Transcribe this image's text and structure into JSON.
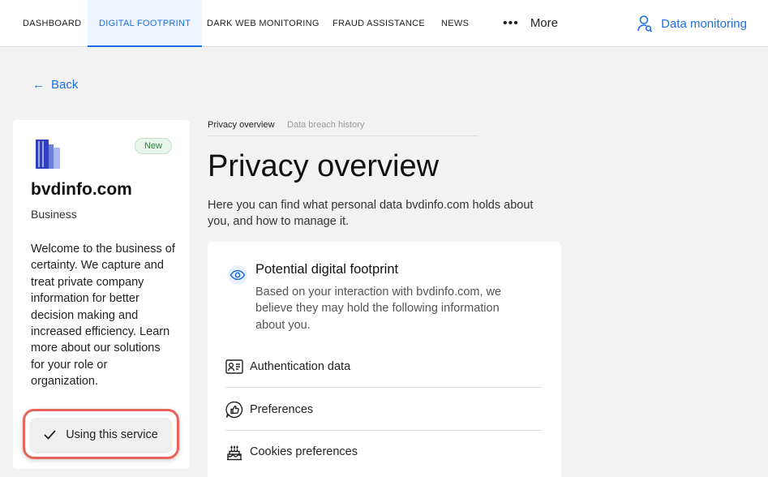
{
  "nav": {
    "items": [
      "DASHBOARD",
      "DIGITAL FOOTPRINT",
      "DARK WEB MONITORING",
      "FRAUD ASSISTANCE",
      "NEWS"
    ],
    "more_label": "More",
    "data_monitoring": "Data monitoring"
  },
  "back_label": "Back",
  "company": {
    "badge": "New",
    "name": "bvdinfo.com",
    "type": "Business",
    "description": "Welcome to the business of certainty. We capture and treat private company information for better decision making and increased efficiency. Learn more about our solutions for your role or organization.",
    "using_label": "Using this service"
  },
  "tabs": [
    "Privacy overview",
    "Data breach history"
  ],
  "page_title": "Privacy overview",
  "intro": "Here you can find what personal data bvdinfo.com holds about you, and how to manage it.",
  "footprint": {
    "title": "Potential digital footprint",
    "description": "Based on your interaction with bvdinfo.com, we believe they may hold the following information about you.",
    "items": [
      {
        "label": "Authentication data",
        "icon": "id-card-icon"
      },
      {
        "label": "Preferences",
        "icon": "thumbs-up-bubble-icon"
      },
      {
        "label": "Cookies preferences",
        "icon": "cake-icon"
      }
    ]
  },
  "colors": {
    "accent": "#1b6ee8",
    "highlight": "#e8645a",
    "badge": "#2e7d3e"
  }
}
